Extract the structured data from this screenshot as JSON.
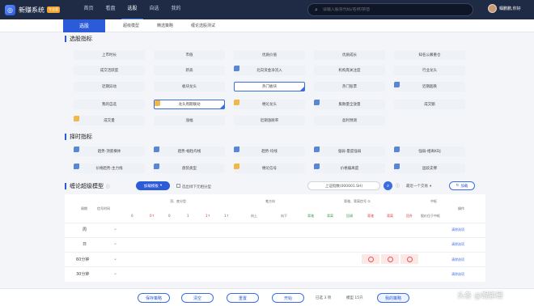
{
  "app": {
    "name": "新赚系统",
    "badge": "专业版"
  },
  "nav": [
    "首页",
    "看盘",
    "选股",
    "自选",
    "我的"
  ],
  "search": {
    "placeholder": "请输入股票代码/名称/拼音"
  },
  "user": {
    "name": "帼鹏鹏,你好"
  },
  "subtabs": {
    "active": "选股",
    "items": [
      "超级模型",
      "精选策略",
      "缠论选股测试"
    ]
  },
  "sections": {
    "stock_indicators": "选股指标",
    "timing_indicators": "择时指标",
    "chan_model": "缠论超级模型"
  },
  "stock_tiles": [
    [
      "上市时长",
      "市值",
      "优质价值",
      "优质成长",
      "知名公募重仓"
    ],
    [
      "成交活跃度",
      "新高",
      "北向资金净流入",
      "机构席关注度",
      "行业龙头"
    ],
    [
      "近期异动",
      "板块龙头",
      "热门板块",
      "热门股票",
      "近期超跌"
    ],
    [
      "我的自选",
      "龙头周期联动",
      "缠论龙头",
      "集散量全放量",
      "成交额"
    ],
    [
      "成交量",
      "涨幅",
      "近期涨跌率",
      "盈利预测"
    ]
  ],
  "timing_tiles": [
    [
      "趋势-顶底横体",
      "趋势-幅粒均线",
      "趋势-均线",
      "强弱-量度强弱",
      "强弱-相离KDJ"
    ],
    [
      "价格趋势-主力线",
      "盘装类型",
      "缠论信号",
      "价格偏离度",
      "固段支撑"
    ]
  ],
  "model_controls": {
    "template_select": "加载模板",
    "checkbox_label": "选出绿下元相分型",
    "index_select": "上证指数(000001.SH)",
    "recent_select": "最近一个交易",
    "load_button": "加载"
  },
  "grid": {
    "headers": {
      "period": "周期",
      "signal_time": "信号时间",
      "group1": "顶、底分型",
      "cols1": [
        "0",
        "0↑",
        "0",
        "1",
        "1↑",
        "1↑"
      ],
      "group2": "笔方向",
      "cols2": [
        "向上",
        "向下"
      ],
      "group3": "背驰、背离信号 ①",
      "cols3": [
        "背驰",
        "背离",
        "回调",
        "背驰",
        "背离",
        "回升"
      ],
      "group4": "中枢",
      "cols4": [
        "股价位于中枢"
      ],
      "ops": "操作"
    },
    "rows": [
      "周",
      "日",
      "60分钟",
      "30分钟"
    ],
    "clear_label": "清除选项"
  },
  "bottom": {
    "save": "保存策略",
    "clear": "清空",
    "reset": "重置",
    "start": "开始",
    "selected_count": "已选 3 项",
    "model_count": "模型 15只",
    "my_strategy": "我的策略"
  },
  "watermark": "头条 @鲲鹏哥"
}
